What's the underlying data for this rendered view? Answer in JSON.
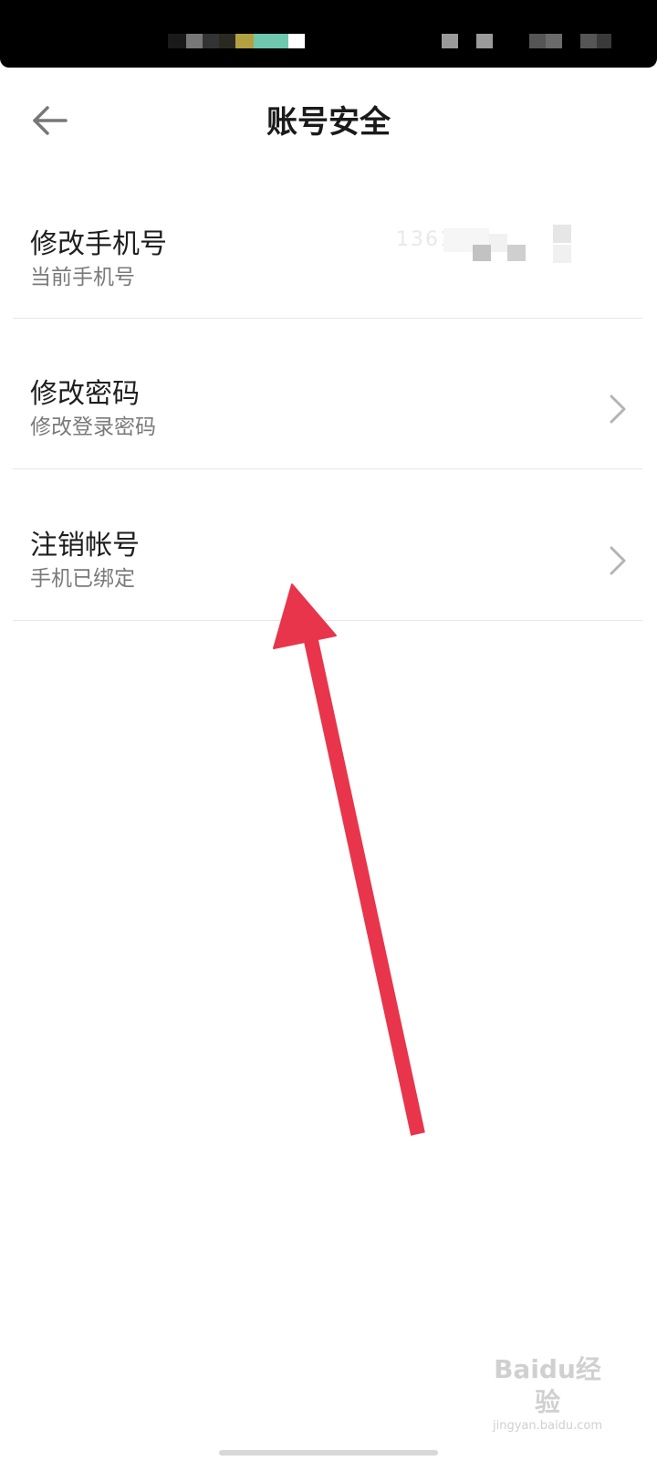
{
  "nav": {
    "title": "账号安全",
    "back_icon": "arrow-left-icon"
  },
  "settings": [
    {
      "title": "修改手机号",
      "subtitle": "当前手机号",
      "value": "1361",
      "value_obscured": true,
      "has_chevron": false
    },
    {
      "title": "修改密码",
      "subtitle": "修改登录密码",
      "has_chevron": true
    },
    {
      "title": "注销帐号",
      "subtitle": "手机已绑定",
      "has_chevron": true
    }
  ],
  "annotation": {
    "type": "arrow",
    "color": "#e8354b",
    "points_to": "注销帐号"
  },
  "watermark": {
    "logo_text": "Baidu经验",
    "url": "jingyan.baidu.com"
  },
  "colors": {
    "status_bar": "#000000",
    "background": "#ffffff",
    "divider": "#e6e6e6",
    "subtitle": "#7a7a7a",
    "chevron": "#b4b4b4"
  }
}
